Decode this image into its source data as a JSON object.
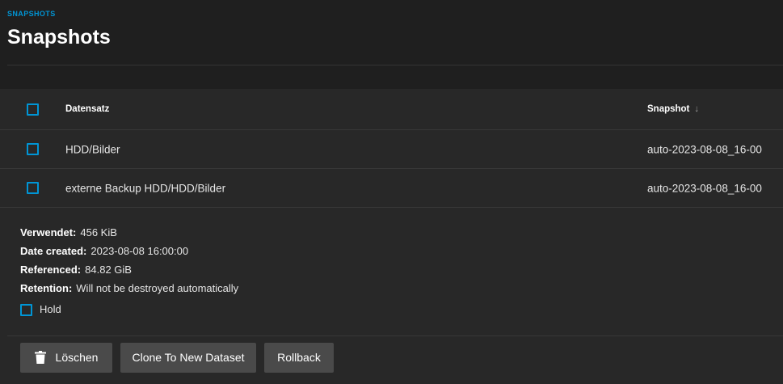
{
  "breadcrumb": "SNAPSHOTS",
  "title": "Snapshots",
  "table": {
    "headers": {
      "dataset": "Datensatz",
      "snapshot": "Snapshot",
      "sort_icon": "arrow-down-icon"
    },
    "rows": [
      {
        "dataset": "HDD/Bilder",
        "snapshot": "auto-2023-08-08_16-00"
      },
      {
        "dataset": "externe Backup HDD/HDD/Bilder",
        "snapshot": "auto-2023-08-08_16-00"
      }
    ]
  },
  "details": {
    "used_label": "Verwendet:",
    "used_value": "456 KiB",
    "created_label": "Date created:",
    "created_value": "2023-08-08 16:00:00",
    "referenced_label": "Referenced:",
    "referenced_value": "84.82 GiB",
    "retention_label": "Retention:",
    "retention_value": "Will not be destroyed automatically",
    "hold_label": "Hold"
  },
  "actions": {
    "delete_label": "Löschen",
    "delete_icon": "trash-icon",
    "clone_label": "Clone To New Dataset",
    "rollback_label": "Rollback"
  },
  "colors": {
    "accent": "#0095d5",
    "background": "#1f1f1f",
    "card": "#282828",
    "button": "#4a4a4a"
  }
}
